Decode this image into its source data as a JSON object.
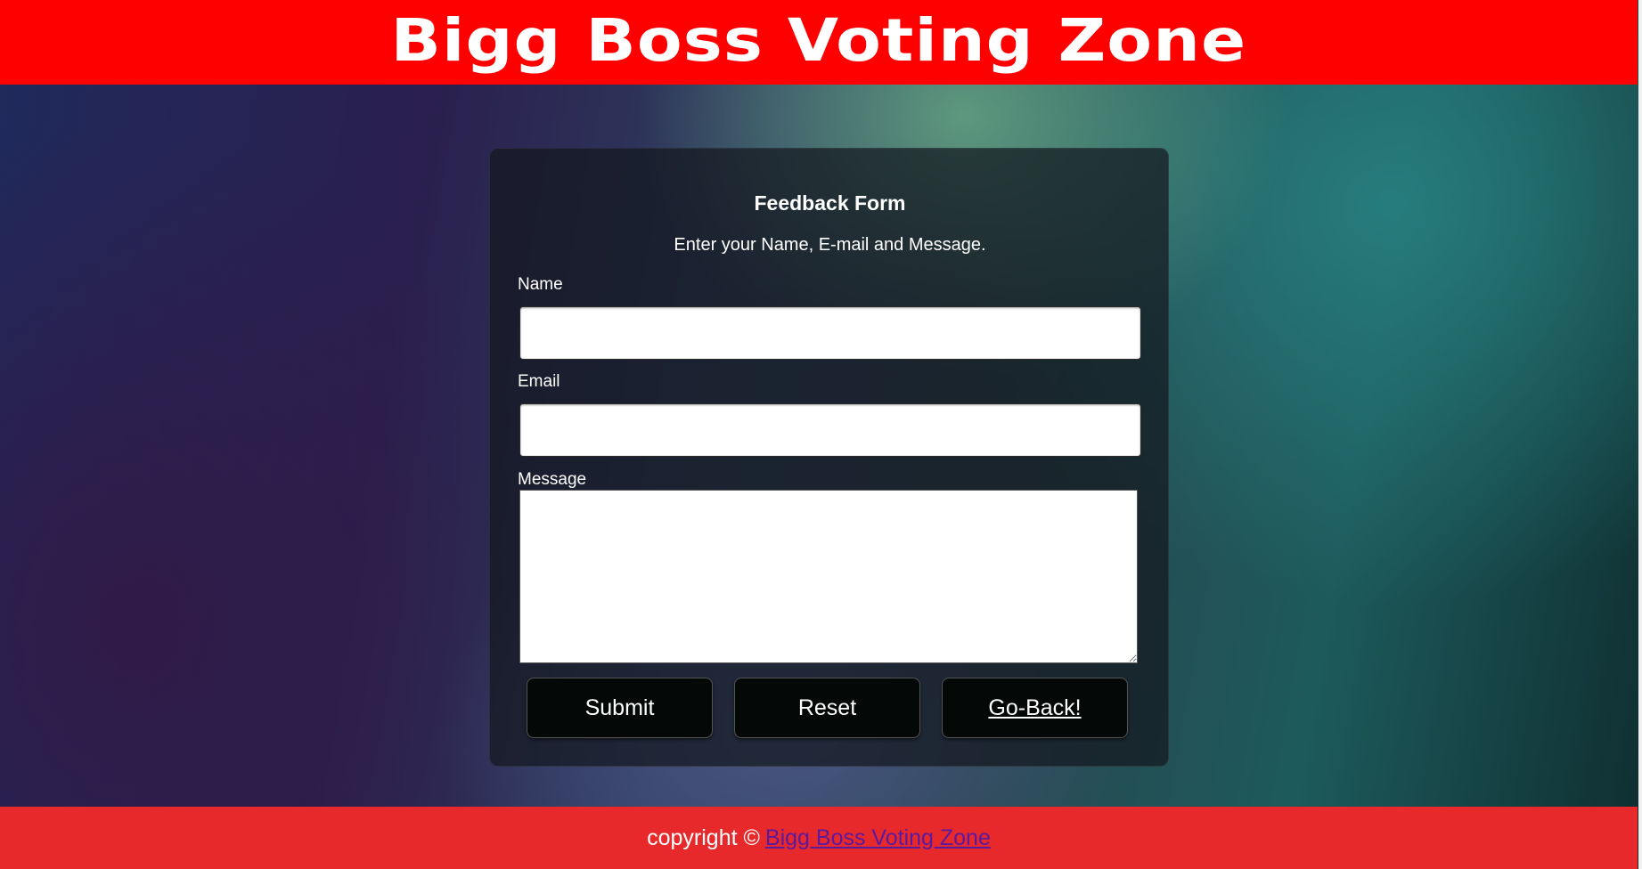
{
  "header": {
    "title": "Bigg Boss Voting Zone"
  },
  "form": {
    "title": "Feedback Form",
    "subtitle": "Enter your Name, E-mail and Message.",
    "name_label": "Name",
    "name_value": "",
    "email_label": "Email",
    "email_value": "",
    "message_label": "Message",
    "message_value": "",
    "submit_label": "Submit",
    "reset_label": "Reset",
    "back_label": "Go-Back!"
  },
  "footer": {
    "copyright_text": "copyright ©",
    "link_text": "Bigg Boss Voting Zone"
  },
  "colors": {
    "header_bg": "#ff0000",
    "footer_bg": "#e8292b",
    "button_bg": "#040806",
    "footer_link": "#5a1aa0"
  }
}
